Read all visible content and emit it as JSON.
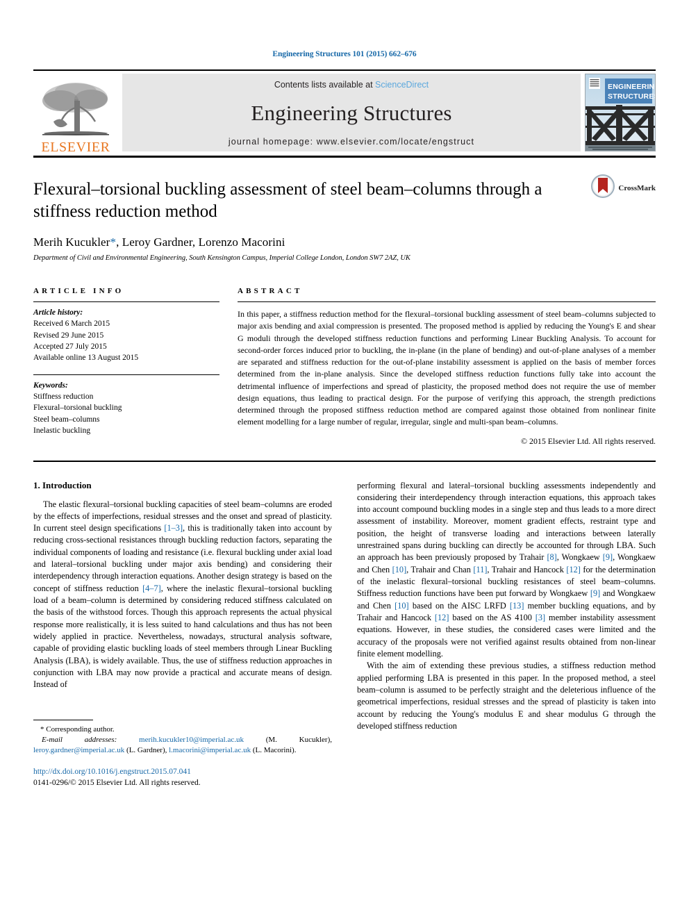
{
  "running_head": "Engineering Structures 101 (2015) 662–676",
  "masthead": {
    "publisher_logo_text": "ELSEVIER",
    "contents_prefix": "Contents lists available at ",
    "contents_link": "ScienceDirect",
    "journal_title": "Engineering Structures",
    "homepage": "journal homepage: www.elsevier.com/locate/engstruct",
    "cover_line1": "ENGINEERING",
    "cover_line2": "STRUCTURES"
  },
  "title_block": {
    "title": "Flexural–torsional buckling assessment of steel beam–columns through a stiffness reduction method",
    "crossmark_label": "CrossMark",
    "authors_pre": "Merih Kucukler",
    "authors_star": "*",
    "authors_post": ", Leroy Gardner, Lorenzo Macorini",
    "affiliation": "Department of Civil and Environmental Engineering, South Kensington Campus, Imperial College London, London SW7 2AZ, UK"
  },
  "article_info": {
    "heading": "ARTICLE INFO",
    "history_label": "Article history:",
    "history": [
      "Received 6 March 2015",
      "Revised 29 June 2015",
      "Accepted 27 July 2015",
      "Available online 13 August 2015"
    ],
    "keywords_label": "Keywords:",
    "keywords": [
      "Stiffness reduction",
      "Flexural–torsional buckling",
      "Steel beam–columns",
      "Inelastic buckling"
    ]
  },
  "abstract": {
    "heading": "ABSTRACT",
    "text": "In this paper, a stiffness reduction method for the flexural–torsional buckling assessment of steel beam–columns subjected to major axis bending and axial compression is presented. The proposed method is applied by reducing the Young's E and shear G moduli through the developed stiffness reduction functions and performing Linear Buckling Analysis. To account for second-order forces induced prior to buckling, the in-plane (in the plane of bending) and out-of-plane analyses of a member are separated and stiffness reduction for the out-of-plane instability assessment is applied on the basis of member forces determined from the in-plane analysis. Since the developed stiffness reduction functions fully take into account the detrimental influence of imperfections and spread of plasticity, the proposed method does not require the use of member design equations, thus leading to practical design. For the purpose of verifying this approach, the strength predictions determined through the proposed stiffness reduction method are compared against those obtained from nonlinear finite element modelling for a large number of regular, irregular, single and multi-span beam–columns.",
    "copyright": "© 2015 Elsevier Ltd. All rights reserved."
  },
  "body": {
    "section_number_title": "1. Introduction",
    "left_para1_a": "The elastic flexural–torsional buckling capacities of steel beam–columns are eroded by the effects of imperfections, residual stresses and the onset and spread of plasticity. In current steel design specifications ",
    "left_ref1": "[1–3]",
    "left_para1_b": ", this is traditionally taken into account by reducing cross-sectional resistances through buckling reduction factors, separating the individual components of loading and resistance (i.e. flexural buckling under axial load and lateral–torsional buckling under major axis bending) and considering their interdependency through interaction equations. Another design strategy is based on the concept of stiffness reduction ",
    "left_ref2": "[4–7]",
    "left_para1_c": ", where the inelastic flexural–torsional buckling load of a beam–column is determined by considering reduced stiffness calculated on the basis of the withstood forces. Though this approach represents the actual physical response more realistically, it is less suited to hand calculations and thus has not been widely applied in practice. Nevertheless, nowadays, structural analysis software, capable of providing elastic buckling loads of steel members through Linear Buckling Analysis (LBA), is widely available. Thus, the use of stiffness reduction approaches in conjunction with LBA may now provide a practical and accurate means of design. Instead of",
    "right_para1_a": "performing flexural and lateral–torsional buckling assessments independently and considering their interdependency through interaction equations, this approach takes into account compound buckling modes in a single step and thus leads to a more direct assessment of instability. Moreover, moment gradient effects, restraint type and position, the height of transverse loading and interactions between laterally unrestrained spans during buckling can directly be accounted for through LBA. Such an approach has been previously proposed by Trahair ",
    "right_ref8": "[8]",
    "right_p_b": ", Wongkaew ",
    "right_ref9": "[9]",
    "right_p_c": ", Wongkaew and Chen ",
    "right_ref10": "[10]",
    "right_p_d": ", Trahair and Chan ",
    "right_ref11": "[11]",
    "right_p_e": ", Trahair and Hancock ",
    "right_ref12": "[12]",
    "right_p_f": " for the determination of the inelastic flexural–torsional buckling resistances of steel beam–columns. Stiffness reduction functions have been put forward by Wongkaew ",
    "right_ref9b": "[9]",
    "right_p_g": " and Wongkaew and Chen ",
    "right_ref10b": "[10]",
    "right_p_h": " based on the AISC LRFD ",
    "right_ref13": "[13]",
    "right_p_i": " member buckling equations, and by Trahair and Hancock ",
    "right_ref12b": "[12]",
    "right_p_j": " based on the AS 4100 ",
    "right_ref3": "[3]",
    "right_p_k": " member instability assessment equations. However, in these studies, the considered cases were limited and the accuracy of the proposals were not verified against results obtained from non-linear finite element modelling.",
    "right_para2": "With the aim of extending these previous studies, a stiffness reduction method applied performing LBA is presented in this paper. In the proposed method, a steel beam–column is assumed to be perfectly straight and the deleterious influence of the geometrical imperfections, residual stresses and the spread of plasticity is taken into account by reducing the Young's modulus E and shear modulus G through the developed stiffness reduction"
  },
  "footnote": {
    "corresponding_star": "*",
    "corresponding": " Corresponding author.",
    "email_label": "E-mail addresses:",
    "email1": "merih.kucukler10@imperial.ac.uk",
    "email1_name": " (M. Kucukler), ",
    "email2": "leroy.gardner@imperial.ac.uk",
    "email2_name": " (L. Gardner), ",
    "email3": "l.macorini@imperial.ac.uk",
    "email3_name": " (L. Macorini).",
    "doi": "http://dx.doi.org/10.1016/j.engstruct.2015.07.041",
    "issn": "0141-0296/© 2015 Elsevier Ltd. All rights reserved."
  },
  "colors": {
    "link_blue": "#1668a8",
    "sciencedirect_blue": "#5aa7dd",
    "elsevier_orange": "#e87722",
    "cover_blue": "#4a82b8"
  }
}
